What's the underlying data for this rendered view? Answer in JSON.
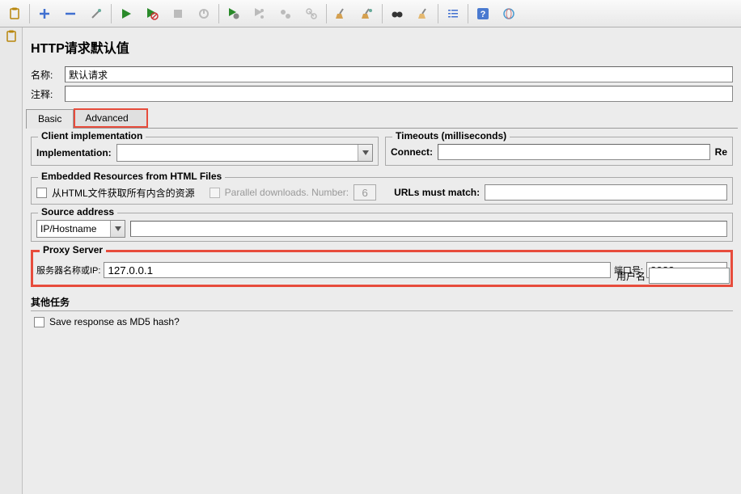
{
  "panel": {
    "title": "HTTP请求默认值",
    "name_label": "名称:",
    "name_value": "默认请求",
    "comment_label": "注释:",
    "comment_value": ""
  },
  "tabs": {
    "basic": "Basic",
    "advanced": "Advanced"
  },
  "client_impl": {
    "legend": "Client implementation",
    "label": "Implementation:",
    "value": ""
  },
  "timeouts": {
    "legend": "Timeouts (milliseconds)",
    "connect_label": "Connect:",
    "connect_value": "",
    "response_label": "Re"
  },
  "embedded": {
    "legend": "Embedded Resources from HTML Files",
    "chk1_label": "从HTML文件获取所有内含的资源",
    "chk2_label": "Parallel downloads. Number:",
    "number_value": "6",
    "urls_label": "URLs must match:",
    "urls_value": ""
  },
  "source": {
    "legend": "Source address",
    "combo_value": "IP/Hostname",
    "field_value": ""
  },
  "proxy": {
    "legend": "Proxy Server",
    "server_label": "服务器名称或IP:",
    "server_value": "127.0.0.1",
    "port_label": "端口号:",
    "port_value": "8888",
    "user_label": "用户名",
    "user_value": ""
  },
  "other": {
    "title": "其他任务",
    "md5_label": "Save response as MD5 hash?"
  }
}
